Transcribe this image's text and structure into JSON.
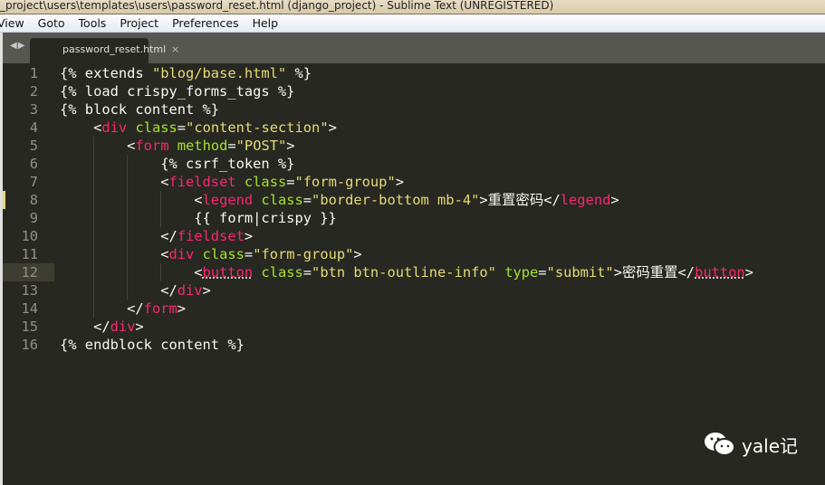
{
  "window": {
    "title": "_project\\users\\templates\\users\\password_reset.html (django_project) - Sublime Text (UNREGISTERED)"
  },
  "menu": [
    "View",
    "Goto",
    "Tools",
    "Project",
    "Preferences",
    "Help"
  ],
  "tab": {
    "label": "password_reset.html",
    "close": "×"
  },
  "current_line": 12,
  "modified_lines": [
    8,
    12
  ],
  "lines": [
    [
      [
        "p",
        "{% extends "
      ],
      [
        "s",
        "\"blog/base.html\""
      ],
      [
        "p",
        " %}"
      ]
    ],
    [
      [
        "p",
        "{% load crispy_forms_tags %}"
      ]
    ],
    [
      [
        "p",
        "{% block content %}"
      ]
    ],
    [
      [
        "p",
        "    <"
      ],
      [
        "t",
        "div"
      ],
      [
        "p",
        " "
      ],
      [
        "a",
        "class"
      ],
      [
        "p",
        "="
      ],
      [
        "s",
        "\"content-section\""
      ],
      [
        "p",
        ">"
      ]
    ],
    [
      [
        "p",
        "        <"
      ],
      [
        "t",
        "form"
      ],
      [
        "p",
        " "
      ],
      [
        "a",
        "method"
      ],
      [
        "p",
        "="
      ],
      [
        "s",
        "\"POST\""
      ],
      [
        "p",
        ">"
      ]
    ],
    [
      [
        "p",
        "            {% csrf_token %}"
      ]
    ],
    [
      [
        "p",
        "            <"
      ],
      [
        "t",
        "fieldset"
      ],
      [
        "p",
        " "
      ],
      [
        "a",
        "class"
      ],
      [
        "p",
        "="
      ],
      [
        "s",
        "\"form-group\""
      ],
      [
        "p",
        ">"
      ]
    ],
    [
      [
        "p",
        "                <"
      ],
      [
        "t",
        "legend"
      ],
      [
        "p",
        " "
      ],
      [
        "a",
        "class"
      ],
      [
        "p",
        "="
      ],
      [
        "s",
        "\"border-bottom mb-4\""
      ],
      [
        "p",
        ">重置密码</"
      ],
      [
        "t",
        "legend"
      ],
      [
        "p",
        ">"
      ]
    ],
    [
      [
        "p",
        "                {{ form|crispy }}"
      ]
    ],
    [
      [
        "p",
        "            </"
      ],
      [
        "t",
        "fieldset"
      ],
      [
        "p",
        ">"
      ]
    ],
    [
      [
        "p",
        "            <"
      ],
      [
        "t",
        "div"
      ],
      [
        "p",
        " "
      ],
      [
        "a",
        "class"
      ],
      [
        "p",
        "="
      ],
      [
        "s",
        "\"form-group\""
      ],
      [
        "p",
        ">"
      ]
    ],
    [
      [
        "p",
        "                <"
      ],
      [
        "tu",
        "button"
      ],
      [
        "p",
        " "
      ],
      [
        "a",
        "class"
      ],
      [
        "p",
        "="
      ],
      [
        "s",
        "\"btn btn-outline-info\""
      ],
      [
        "p",
        " "
      ],
      [
        "a",
        "type"
      ],
      [
        "p",
        "="
      ],
      [
        "s",
        "\"submit\""
      ],
      [
        "p",
        ">密码重置</"
      ],
      [
        "tu",
        "button"
      ],
      [
        "p",
        ">"
      ]
    ],
    [
      [
        "p",
        "            </"
      ],
      [
        "t",
        "div"
      ],
      [
        "p",
        ">"
      ]
    ],
    [
      [
        "p",
        "        </"
      ],
      [
        "t",
        "form"
      ],
      [
        "p",
        ">"
      ]
    ],
    [
      [
        "p",
        "    </"
      ],
      [
        "t",
        "div"
      ],
      [
        "p",
        ">"
      ]
    ],
    [
      [
        "p",
        "{% endblock content %}"
      ]
    ]
  ],
  "watermark": {
    "text": "yale记",
    "icon": "wechat-icon"
  },
  "colors": {
    "background": "#272822",
    "tag": "#f92672",
    "attribute": "#a6e22e",
    "string": "#e6db74",
    "text": "#f8f8f2"
  }
}
